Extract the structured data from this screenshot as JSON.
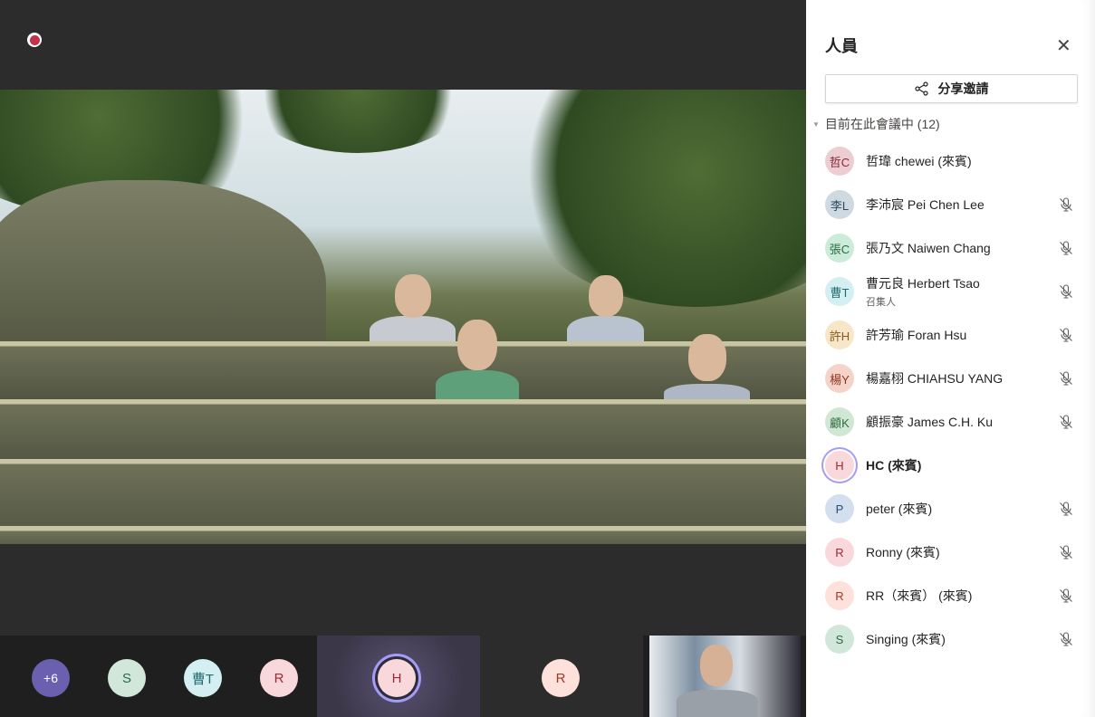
{
  "panel": {
    "title": "人員",
    "share_label": "分享邀請",
    "section_label": "目前在此會議中 (12)",
    "participants": [
      {
        "initials": "哲C",
        "name": "哲瑋 chewei (來賓)",
        "muted": false,
        "bg": "#eccdd2",
        "fg": "#8a2a3a"
      },
      {
        "initials": "李L",
        "name": "李沛宸 Pei Chen Lee",
        "muted": true,
        "bg": "#cfd9e1",
        "fg": "#2b4a5e"
      },
      {
        "initials": "張C",
        "name": "張乃文 Naiwen Chang",
        "muted": true,
        "bg": "#caecd9",
        "fg": "#2a6a47"
      },
      {
        "initials": "曹T",
        "name": "曹元良 Herbert Tsao",
        "role": "召集人",
        "muted": true,
        "bg": "#d3eff1",
        "fg": "#236a70"
      },
      {
        "initials": "許H",
        "name": "許芳瑜 Foran Hsu",
        "muted": true,
        "bg": "#f8e6c8",
        "fg": "#8a5a1a"
      },
      {
        "initials": "楊Y",
        "name": "楊嘉栩 CHIAHSU YANG",
        "muted": true,
        "bg": "#f6d3c9",
        "fg": "#8a3520"
      },
      {
        "initials": "顧K",
        "name": "顧振豪 James C.H. Ku",
        "muted": true,
        "bg": "#d1e7d5",
        "fg": "#2d6a3a"
      },
      {
        "initials": "H",
        "name": "HC (來賓)",
        "muted": false,
        "speaking": true,
        "bg": "#f9d8dc",
        "fg": "#9a2a3a"
      },
      {
        "initials": "P",
        "name": "peter (來賓)",
        "muted": true,
        "bg": "#d3deef",
        "fg": "#2b4a7a"
      },
      {
        "initials": "R",
        "name": "Ronny (來賓)",
        "muted": true,
        "bg": "#f9d8dc",
        "fg": "#9a2a3a"
      },
      {
        "initials": "R",
        "name": "RR（來賓） (來賓)",
        "muted": true,
        "bg": "#fde1da",
        "fg": "#9a3a2a"
      },
      {
        "initials": "S",
        "name": "Singing (來賓)",
        "muted": true,
        "bg": "#d1e7da",
        "fg": "#2a6a47"
      }
    ]
  },
  "bottom": {
    "overflow": "+6",
    "tiles": [
      {
        "initials": "S",
        "bg": "#d1e7da",
        "fg": "#2a6a47"
      },
      {
        "initials": "曹T",
        "bg": "#d3eff1",
        "fg": "#236a70"
      },
      {
        "initials": "R",
        "bg": "#f9d8dc",
        "fg": "#9a2a3a"
      },
      {
        "initials": "H",
        "bg": "#f9d8dc",
        "fg": "#9a2a3a"
      },
      {
        "initials": "R",
        "bg": "#fde1da",
        "fg": "#9a3a2a"
      }
    ]
  }
}
